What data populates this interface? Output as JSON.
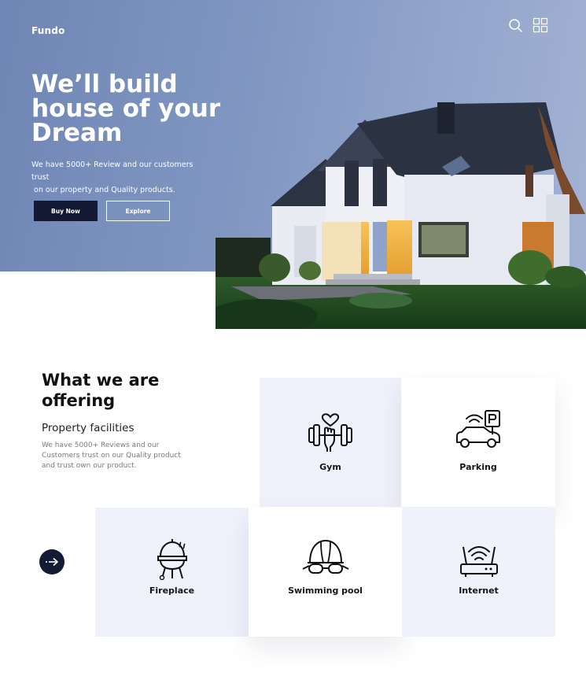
{
  "brand": "Fundo",
  "hero": {
    "headline": [
      "We’ll build",
      "house of your",
      "Dream"
    ],
    "subtitle_lines": [
      "We have 5000+ Review and our customers trust",
      " on our property and Quality products."
    ],
    "buy_label": "Buy Now",
    "explore_label": "Explore"
  },
  "offering": {
    "title": [
      "What we are",
      "offering"
    ],
    "subtitle": "Property facilities",
    "description_lines": [
      "We have 5000+ Reviews and our",
      "Customers trust on our Quality product",
      "and trust own our product."
    ]
  },
  "facilities": [
    {
      "label": "Gym",
      "icon": "gym-icon"
    },
    {
      "label": "Parking",
      "icon": "parking-icon"
    },
    {
      "label": "Fireplace",
      "icon": "grill-icon"
    },
    {
      "label": "Swimming pool",
      "icon": "swimming-cap-goggles-icon"
    },
    {
      "label": "Internet",
      "icon": "wifi-router-icon"
    }
  ],
  "colors": {
    "hero_bg": "#8298c3",
    "dark_button": "#121a33",
    "card_blue": "#eff1fb"
  }
}
